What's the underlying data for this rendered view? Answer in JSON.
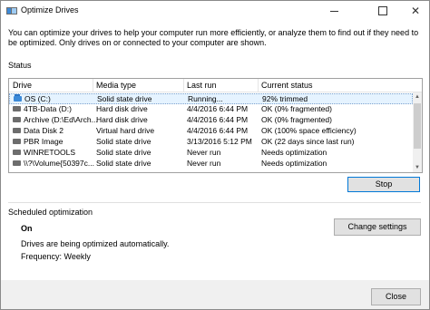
{
  "window": {
    "title": "Optimize Drives",
    "close_glyph": "✕"
  },
  "intro_text": "You can optimize your drives to help your computer run more efficiently, or analyze them to find out if they need to be optimized. Only drives on or connected to your computer are shown.",
  "status_section": {
    "label": "Status",
    "columns": [
      "Drive",
      "Media type",
      "Last run",
      "Current status"
    ],
    "rows": [
      {
        "drive": "OS (C:)",
        "media": "Solid state drive",
        "last_run": "Running...",
        "status": "92% trimmed",
        "icon": "os-drive-icon"
      },
      {
        "drive": "4TB-Data (D:)",
        "media": "Hard disk drive",
        "last_run": "4/4/2016 6:44 PM",
        "status": "OK (0% fragmented)",
        "icon": "hard-drive-icon"
      },
      {
        "drive": "Archive (D:\\Ed\\Arch...",
        "media": "Hard disk drive",
        "last_run": "4/4/2016 6:44 PM",
        "status": "OK (0% fragmented)",
        "icon": "hard-drive-icon"
      },
      {
        "drive": "Data Disk 2",
        "media": "Virtual hard drive",
        "last_run": "4/4/2016 6:44 PM",
        "status": "OK (100% space efficiency)",
        "icon": "hard-drive-icon"
      },
      {
        "drive": "PBR Image",
        "media": "Solid state drive",
        "last_run": "3/13/2016 5:12 PM",
        "status": "OK (22 days since last run)",
        "icon": "hard-drive-icon"
      },
      {
        "drive": "WINRETOOLS",
        "media": "Solid state drive",
        "last_run": "Never run",
        "status": "Needs optimization",
        "icon": "hard-drive-icon"
      },
      {
        "drive": "\\\\?\\Volume{50397c...",
        "media": "Solid state drive",
        "last_run": "Never run",
        "status": "Needs optimization",
        "icon": "hard-drive-icon"
      }
    ],
    "stop_label": "Stop"
  },
  "scheduled": {
    "label": "Scheduled optimization",
    "state": "On",
    "description": "Drives are being optimized automatically.",
    "frequency": "Frequency: Weekly",
    "change_label": "Change settings"
  },
  "footer": {
    "close_label": "Close"
  }
}
